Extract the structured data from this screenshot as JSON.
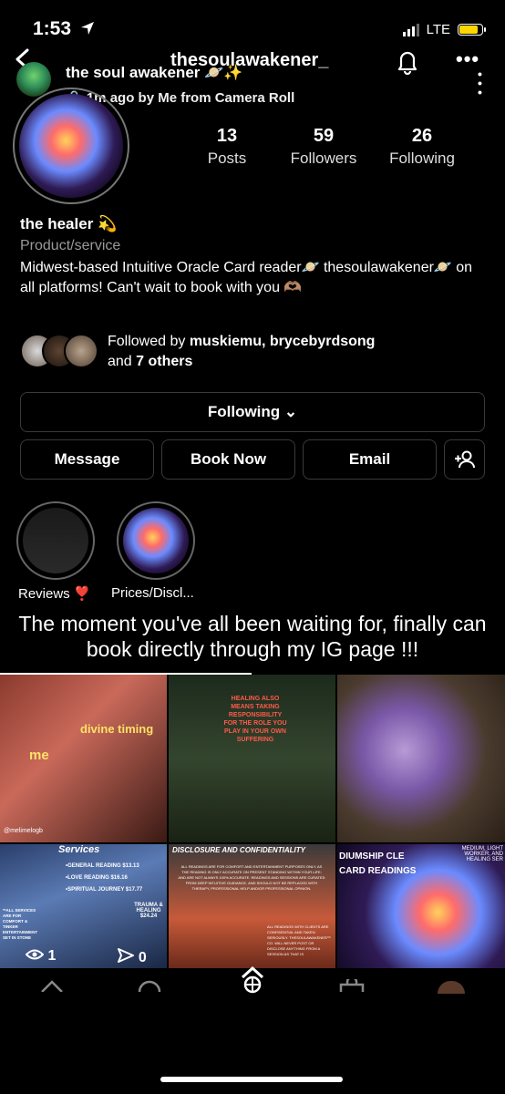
{
  "status": {
    "time": "1:53",
    "network": "LTE",
    "battery_color": "#ffd600"
  },
  "header": {
    "username": "thesoulawakener_"
  },
  "story": {
    "title": "the soul awakener 🪐✨",
    "meta": "🔒 1m ago by Me from Camera Roll"
  },
  "stats": [
    {
      "value": "13",
      "label": "Posts"
    },
    {
      "value": "59",
      "label": "Followers"
    },
    {
      "value": "26",
      "label": "Following"
    }
  ],
  "bio": {
    "name": "the healer 💫",
    "category": "Product/service",
    "text": "Midwest-based Intuitive Oracle Card reader🪐 thesoulawakener🪐 on all platforms! Can't wait to book with you 🫶🏽"
  },
  "followed_by": {
    "prefix": "Followed by ",
    "names": "muskiemu, brycebyrdsong",
    "and": "and ",
    "others": "7 others"
  },
  "buttons": {
    "following": "Following ⌄",
    "message": "Message",
    "book": "Book Now",
    "email": "Email"
  },
  "highlights": [
    {
      "label": "Reviews ❣️"
    },
    {
      "label": "Prices/Discl..."
    }
  ],
  "caption": "The moment you've all been waiting for, finally can book directly through my IG page !!!",
  "grid": {
    "tile1": {
      "texts": [
        "divine timing",
        "me",
        "@melimelogb"
      ]
    },
    "tile2": {
      "text": "HEALING ALSO MEANS TAKING RESPONSIBILITY FOR THE ROLE YOU PLAY IN YOUR OWN SUFFERING"
    },
    "tile4": {
      "title": "Services",
      "lines": [
        "•GENERAL READING $13.13",
        "•LOVE READING $16.16",
        "•SPIRITUAL JOURNEY $17.77"
      ],
      "badge": "TRAUMA & HEALING $24.24",
      "note": "**ALL SERVICES ARE FOR COMFORT & TINKER ENTERTAINMENT SET IN STONE"
    },
    "tile5": {
      "title": "DISCLOSURE AND CONFIDENTIALITY",
      "body": "ALL READINGS ARE FOR COMFORT AND ENTERTAINMENT PURPOSES ONLY, AS THE READING IS ONLY ACCURATE ON PRESENT STANDING WITHIN YOUR LIFE; AND ARE NOT ALWAYS 100% ACCURATE. READINGS AND SESSIONS ARE CURATED FROM DEEP INTUITIVE GUIDANCE, AND SHOULD NOT BE REPLACED WITH THERAPY, PROFESSIONAL HELP AND/OR PROFESSIONAL OPINION.",
      "body2": "ALL READINGS WITH CLIENTS ARE CONFIDENTIAL AND TAKEN SERIOUSLY. THESOULAWAKENER™ CO. WILL NEVER POST OR DISCLOSE ANYTHING FROM A SESSION AS THAT IS"
    },
    "tile6": {
      "left_text": "DIUMSHIP CLE CARD READINGS",
      "right_text": "MEDIUM, LIGHT WORKER, AND HEALING SER"
    }
  },
  "view_stats": {
    "views": "1",
    "shares": "0"
  }
}
